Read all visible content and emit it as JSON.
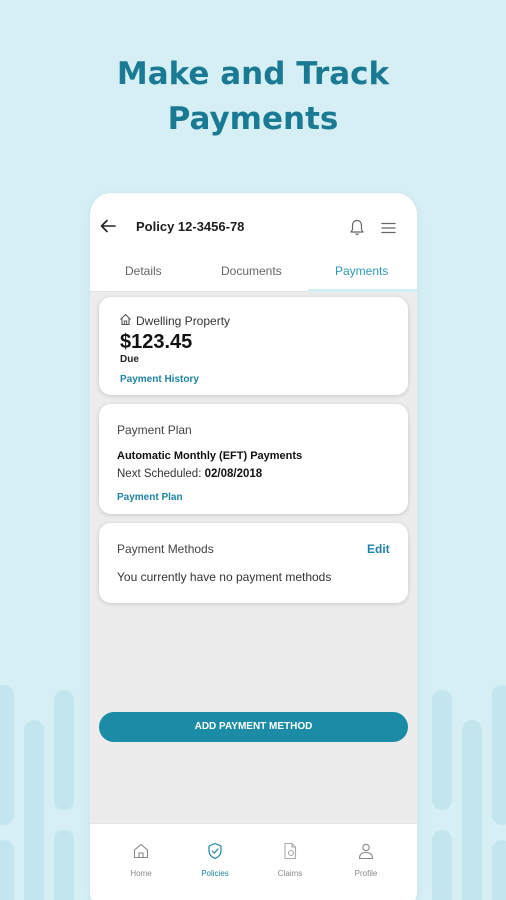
{
  "hero": {
    "line1": "Make and Track",
    "line2": "Payments"
  },
  "header": {
    "back_icon": "back-arrow-icon",
    "title": "Policy 12-3456-78",
    "notification_icon": "bell-icon",
    "menu_icon": "menu-icon"
  },
  "tabs": [
    {
      "label": "Details",
      "active": false
    },
    {
      "label": "Documents",
      "active": false
    },
    {
      "label": "Payments",
      "active": true
    }
  ],
  "property_card": {
    "icon": "house-icon",
    "property_name": "Dwelling Property",
    "amount": "$123.45",
    "amount_status": "Due",
    "history_link": "Payment History"
  },
  "plan_card": {
    "heading": "Payment Plan",
    "plan_name": "Automatic Monthly (EFT) Payments",
    "next_label": "Next Scheduled:",
    "next_date": "02/08/2018",
    "plan_link": "Payment Plan"
  },
  "methods_card": {
    "heading": "Payment Methods",
    "edit_label": "Edit",
    "empty_message": "You currently have no payment methods"
  },
  "add_button": "ADD PAYMENT METHOD",
  "bottom_nav": [
    {
      "label": "Home",
      "icon": "home-icon",
      "active": false
    },
    {
      "label": "Policies",
      "icon": "shield-check-icon",
      "active": true
    },
    {
      "label": "Claims",
      "icon": "claims-document-icon",
      "active": false
    },
    {
      "label": "Profile",
      "icon": "person-icon",
      "active": false
    }
  ],
  "colors": {
    "background": "#d5eff4",
    "headline": "#1b7a93",
    "accent": "#1b8ba6",
    "link": "#1f84a4",
    "active_tab": "#2d9ab5"
  }
}
